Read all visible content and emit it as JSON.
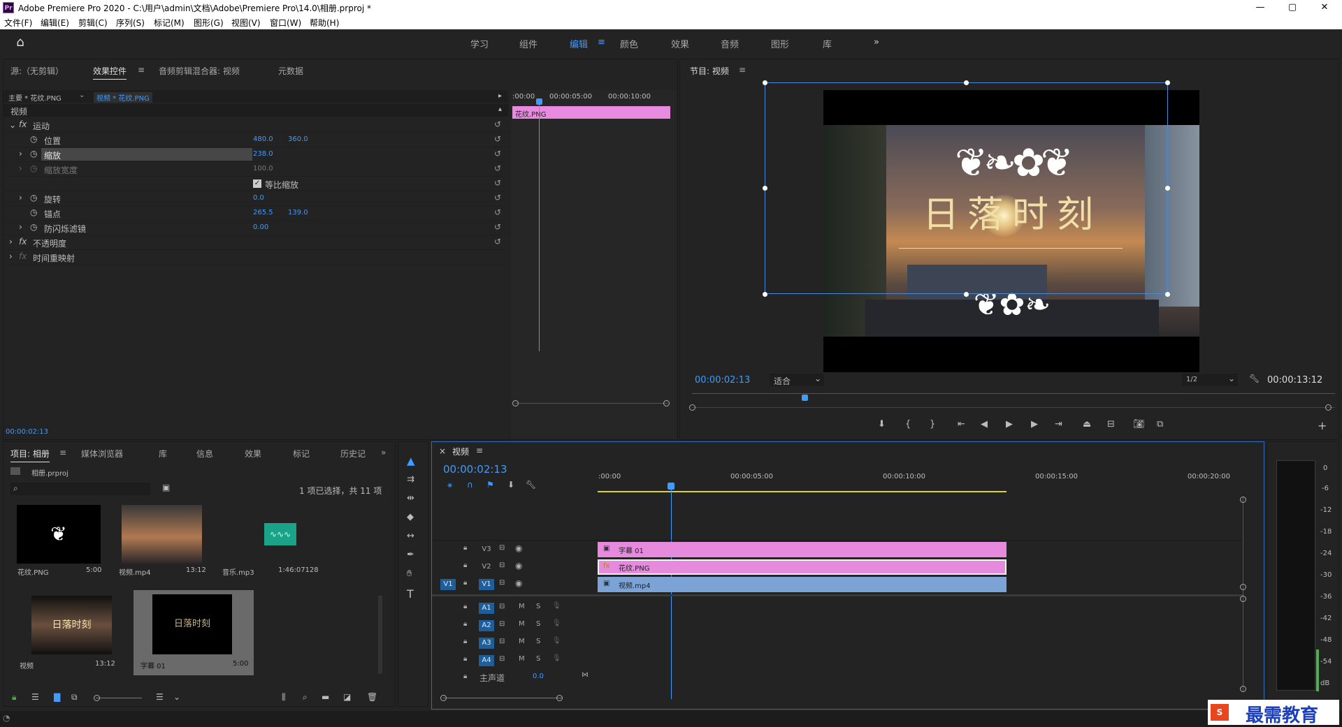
{
  "window": {
    "title": "Adobe Premiere Pro 2020 - C:\\用户\\admin\\文档\\Adobe\\Premiere Pro\\14.0\\相册.prproj *",
    "logo": "Pr",
    "controls": [
      "—",
      "▢",
      "✕"
    ]
  },
  "menu": [
    "文件(F)",
    "编辑(E)",
    "剪辑(C)",
    "序列(S)",
    "标记(M)",
    "图形(G)",
    "视图(V)",
    "窗口(W)",
    "帮助(H)"
  ],
  "workspaces": [
    "学习",
    "组件",
    "编辑",
    "颜色",
    "效果",
    "音频",
    "图形",
    "库"
  ],
  "workspace_active": "编辑",
  "workspace_more": "»",
  "effect_panel": {
    "tabs": [
      "源:（无剪辑）",
      "效果控件",
      "音频剪辑混合器: 视频",
      "元数据"
    ],
    "master_clip": "主要 * 花纹.PNG",
    "sequence_clip": "视频 * 花纹.PNG",
    "section_video": "视频",
    "motion": "运动",
    "props": [
      {
        "name": "位置",
        "v1": "480.0",
        "v2": "360.0"
      },
      {
        "name": "缩放",
        "v1": "238.0",
        "v2": ""
      },
      {
        "name": "缩放宽度",
        "v1": "100.0",
        "v2": ""
      },
      {
        "name": "等比缩放",
        "v1": "",
        "v2": ""
      },
      {
        "name": "旋转",
        "v1": "0.0",
        "v2": ""
      },
      {
        "name": "锚点",
        "v1": "265.5",
        "v2": "139.0"
      },
      {
        "name": "防闪烁滤镜",
        "v1": "0.00",
        "v2": ""
      }
    ],
    "opacity": "不透明度",
    "time_remap": "时间重映射",
    "mini_ruler": [
      ":00:00",
      "00:00:05:00",
      "00:00:10:00"
    ],
    "mini_clip": "花纹.PNG",
    "current_time": "00:00:02:13"
  },
  "program": {
    "title": "节目: 视频",
    "timecode": "00:00:02:13",
    "fit": "适合",
    "resolution": "1/2",
    "duration": "00:00:13:12",
    "overlay_text": "日落时刻"
  },
  "project": {
    "tabs": [
      "项目: 相册",
      "媒体浏览器",
      "库",
      "信息",
      "效果",
      "标记",
      "历史记"
    ],
    "file": "相册.prproj",
    "search_placeholder": "",
    "selection": "1 项已选择，共 11 项",
    "items": [
      {
        "name": "花纹.PNG",
        "dur": "5:00"
      },
      {
        "name": "视频.mp4",
        "dur": "13:12"
      },
      {
        "name": "音乐.mp3",
        "dur": "1:46:07128"
      },
      {
        "name": "视频",
        "dur": "13:12"
      },
      {
        "name": "字幕 01",
        "dur": "5:00"
      }
    ],
    "thumb_text": "日落时刻"
  },
  "timeline": {
    "title": "视频",
    "timecode": "00:00:02:13",
    "ruler": [
      ":00:00",
      "00:00:05:00",
      "00:00:10:00",
      "00:00:15:00",
      "00:00:20:00"
    ],
    "video_tracks": [
      "V3",
      "V2",
      "V1"
    ],
    "source_patch": "V1",
    "clips": [
      "字幕 01",
      "花纹.PNG",
      "视频.mp4"
    ],
    "audio_tracks": [
      "A1",
      "A2",
      "A3",
      "A4"
    ],
    "mute": "M",
    "solo": "S",
    "master": "主声道",
    "master_value": "0.0"
  },
  "meter_scale": [
    "0",
    "-6",
    "-12",
    "-18",
    "-24",
    "-30",
    "-36",
    "-42",
    "-48",
    "-54",
    "dB"
  ],
  "watermark": "最需教育"
}
